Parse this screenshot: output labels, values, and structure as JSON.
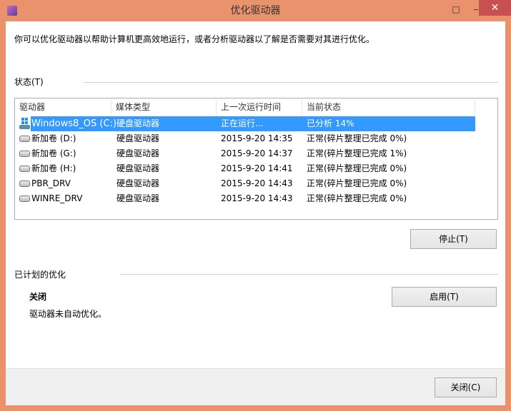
{
  "window": {
    "title": "优化驱动器",
    "minimize": "‒",
    "maximize": "□",
    "close": "✕"
  },
  "description": "你可以优化驱动器以帮助计算机更高效地运行，或者分析驱动器以了解是否需要对其进行优化。",
  "status": {
    "section_label": "状态(T)",
    "columns": [
      "驱动器",
      "媒体类型",
      "上一次运行时间",
      "当前状态"
    ],
    "rows": [
      {
        "drive": "Windows8_OS (C:)",
        "media": "硬盘驱动器",
        "last_run": "正在运行...",
        "status": "已分析 14%",
        "icon": "windows-drive-icon",
        "selected": true
      },
      {
        "drive": "新加卷 (D:)",
        "media": "硬盘驱动器",
        "last_run": "2015-9-20 14:35",
        "status": "正常(碎片整理已完成 0%)",
        "icon": "hard-drive-icon"
      },
      {
        "drive": "新加卷 (G:)",
        "media": "硬盘驱动器",
        "last_run": "2015-9-20 14:37",
        "status": "正常(碎片整理已完成 1%)",
        "icon": "hard-drive-icon"
      },
      {
        "drive": "新加卷 (H:)",
        "media": "硬盘驱动器",
        "last_run": "2015-9-20 14:41",
        "status": "正常(碎片整理已完成 0%)",
        "icon": "hard-drive-icon"
      },
      {
        "drive": "PBR_DRV",
        "media": "硬盘驱动器",
        "last_run": "2015-9-20 14:43",
        "status": "正常(碎片整理已完成 0%)",
        "icon": "hard-drive-icon"
      },
      {
        "drive": "WINRE_DRV",
        "media": "硬盘驱动器",
        "last_run": "2015-9-20 14:43",
        "status": "正常(碎片整理已完成 0%)",
        "icon": "hard-drive-icon"
      }
    ],
    "stop_button": "停止(T)"
  },
  "scheduled": {
    "section_label": "已计划的优化",
    "state": "关闭",
    "detail": "驱动器未自动优化。",
    "enable_button": "启用(T)"
  },
  "footer": {
    "close_button": "关闭(C)"
  }
}
